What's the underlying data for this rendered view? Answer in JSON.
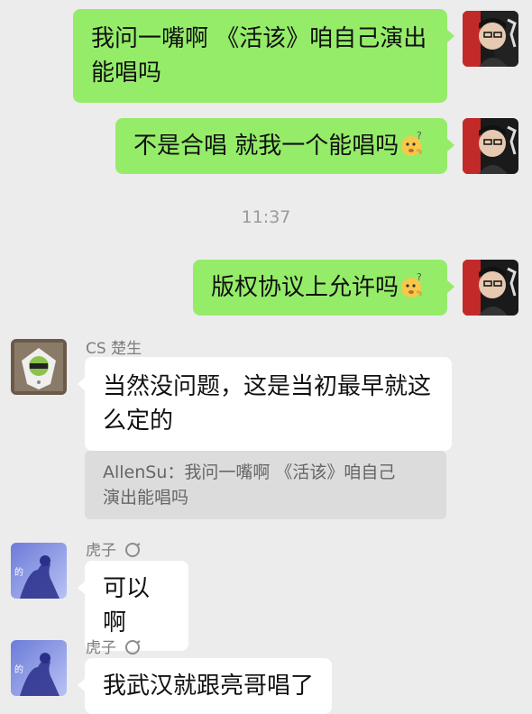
{
  "messages": {
    "m1": {
      "text_line1": "我问一嘴啊 《活该》咱自己演出",
      "text_line2": "能唱吗"
    },
    "m2": {
      "text": "不是合唱 就我一个能唱吗",
      "emoji": "thinking-face"
    },
    "timestamp": "11:37",
    "m3": {
      "text": "版权协议上允许吗",
      "emoji": "thinking-face"
    },
    "m4": {
      "sender": "CS 楚生",
      "text_line1": "当然没问题，这是当初最早就这",
      "text_line2": "么定的",
      "quote_line1": "AllenSu：我问一嘴啊 《活该》咱自己",
      "quote_line2": "演出能唱吗"
    },
    "m5": {
      "sender": "虎子",
      "text": "可以啊"
    },
    "m6": {
      "sender": "虎子",
      "text": "我武汉就跟亮哥唱了"
    }
  },
  "colors": {
    "self_bubble": "#95ec69",
    "other_bubble": "#ffffff",
    "background": "#ececec"
  }
}
